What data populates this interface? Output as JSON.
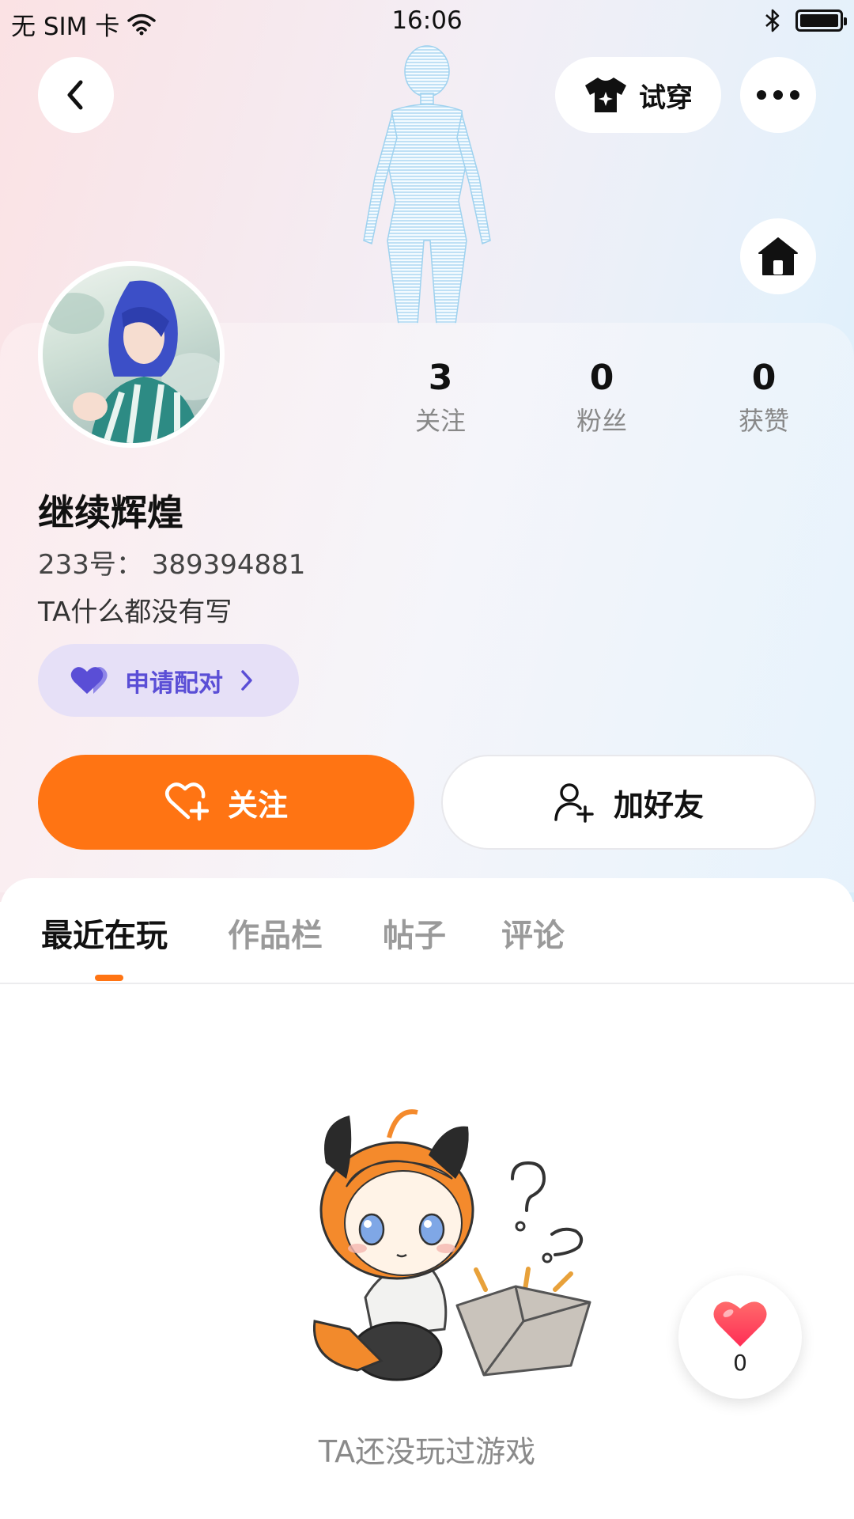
{
  "status_bar": {
    "carrier": "无 SIM 卡",
    "time": "16:06"
  },
  "header": {
    "try_on_label": "试穿"
  },
  "profile": {
    "nickname": "继续辉煌",
    "uid_text": "233号：  389394881",
    "bio": "TA什么都没有写",
    "pair_label": "申请配对"
  },
  "stats": [
    {
      "value": "3",
      "label": "关注"
    },
    {
      "value": "0",
      "label": "粉丝"
    },
    {
      "value": "0",
      "label": "获赞"
    }
  ],
  "actions": {
    "follow_label": "关注",
    "add_friend_label": "加好友"
  },
  "tabs": [
    {
      "label": "最近在玩",
      "active": true
    },
    {
      "label": "作品栏",
      "active": false
    },
    {
      "label": "帖子",
      "active": false
    },
    {
      "label": "评论",
      "active": false
    }
  ],
  "empty_state": {
    "message": "TA还没玩过游戏"
  },
  "floating_like": {
    "count": "0"
  },
  "colors": {
    "accent_orange": "#ff7413",
    "pair_purple": "#5a4ed6",
    "pair_bg": "#e6e0f7",
    "heart_red": "#ff3b47"
  },
  "icons": {
    "back": "chevron-left-icon",
    "try_on": "tshirt-icon",
    "more": "more-dots-icon",
    "home": "home-icon",
    "pair": "double-heart-icon",
    "follow": "heart-plus-icon",
    "add_friend": "user-plus-icon",
    "like": "heart-icon"
  }
}
